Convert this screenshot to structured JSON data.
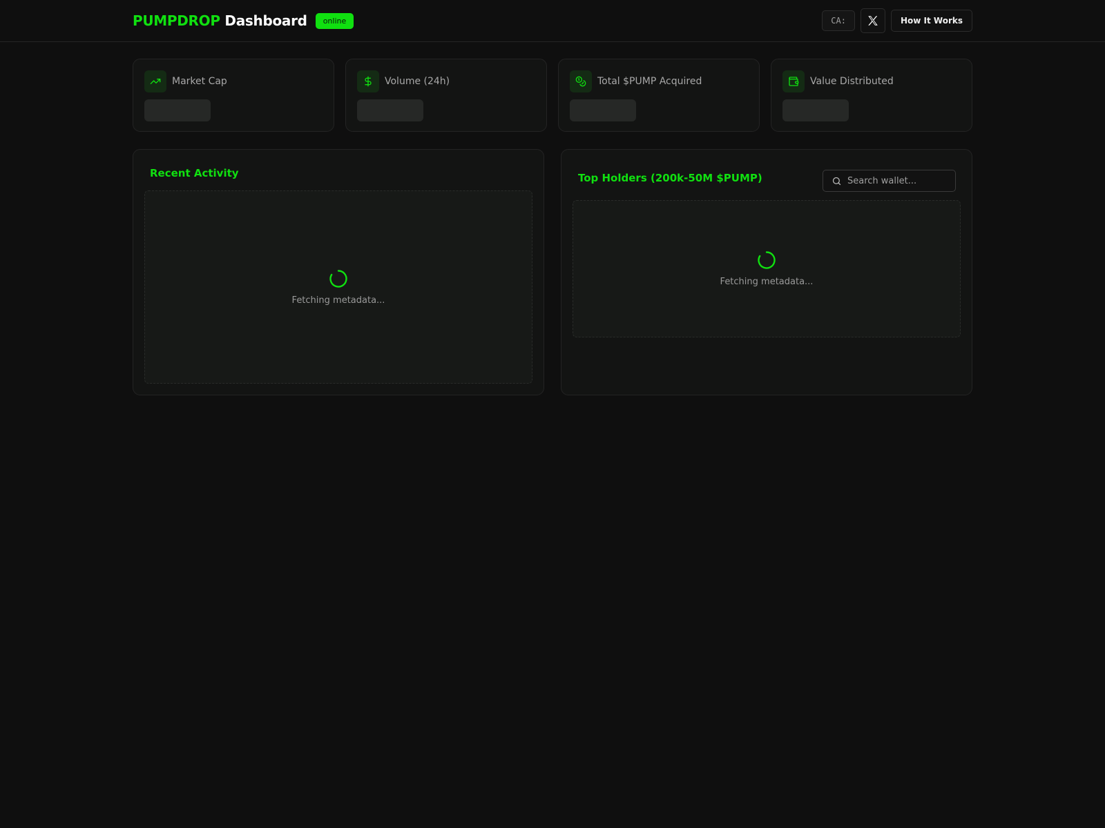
{
  "header": {
    "brand_accent": "PUMPDROP",
    "brand_rest": "Dashboard",
    "status_badge": "online",
    "ca_label": "CA:",
    "x_icon": "x-logo-icon",
    "how_it_works": "How It Works"
  },
  "stats": [
    {
      "label": "Market Cap",
      "icon": "trending-up-icon"
    },
    {
      "label": "Volume (24h)",
      "icon": "dollar-sign-icon"
    },
    {
      "label": "Total $PUMP Acquired",
      "icon": "coins-icon"
    },
    {
      "label": "Value Distributed",
      "icon": "wallet-icon"
    }
  ],
  "recent_activity": {
    "title": "Recent Activity",
    "loading_text": "Fetching metadata..."
  },
  "top_holders": {
    "title": "Top Holders (200k-50M $PUMP)",
    "search_placeholder": "Search wallet...",
    "loading_text": "Fetching metadata..."
  },
  "colors": {
    "accent": "#10e010",
    "background": "#0f0f0f",
    "card": "#131413"
  }
}
